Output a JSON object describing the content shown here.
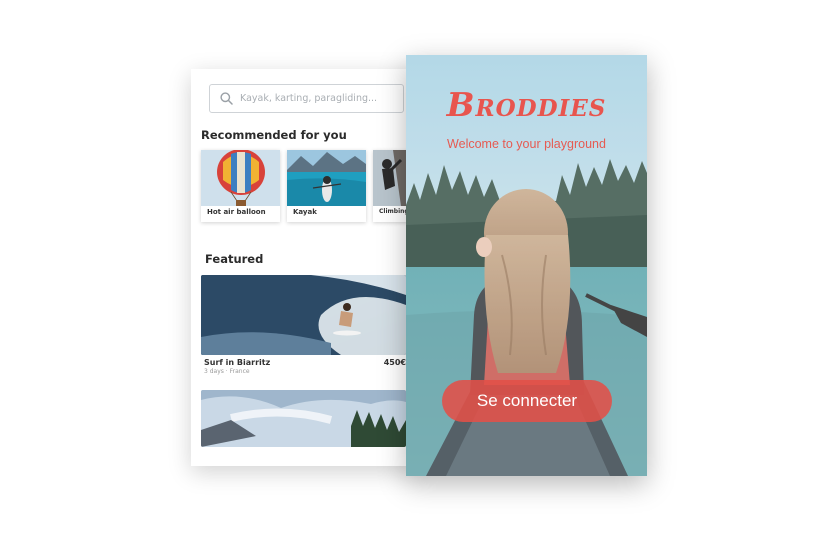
{
  "browse": {
    "search": {
      "placeholder": "Kayak, karting, paragliding..."
    },
    "recommended": {
      "title": "Recommended for you",
      "items": [
        {
          "label": "Hot air balloon"
        },
        {
          "label": "Kayak"
        },
        {
          "label": "Climbing"
        }
      ]
    },
    "featured": {
      "title": "Featured",
      "items": [
        {
          "name": "Surf in Biarritz",
          "meta": "3 days · France",
          "price": "450€"
        }
      ]
    }
  },
  "login": {
    "brand": "Broddies",
    "tagline": "Welcome to your playground",
    "connect_label": "Se connecter"
  },
  "colors": {
    "accent": "#e8554e",
    "button": "#e25048",
    "text_dark": "#2b2b2b",
    "text_muted": "#9a9a9a"
  },
  "icons": [
    "search-icon"
  ]
}
